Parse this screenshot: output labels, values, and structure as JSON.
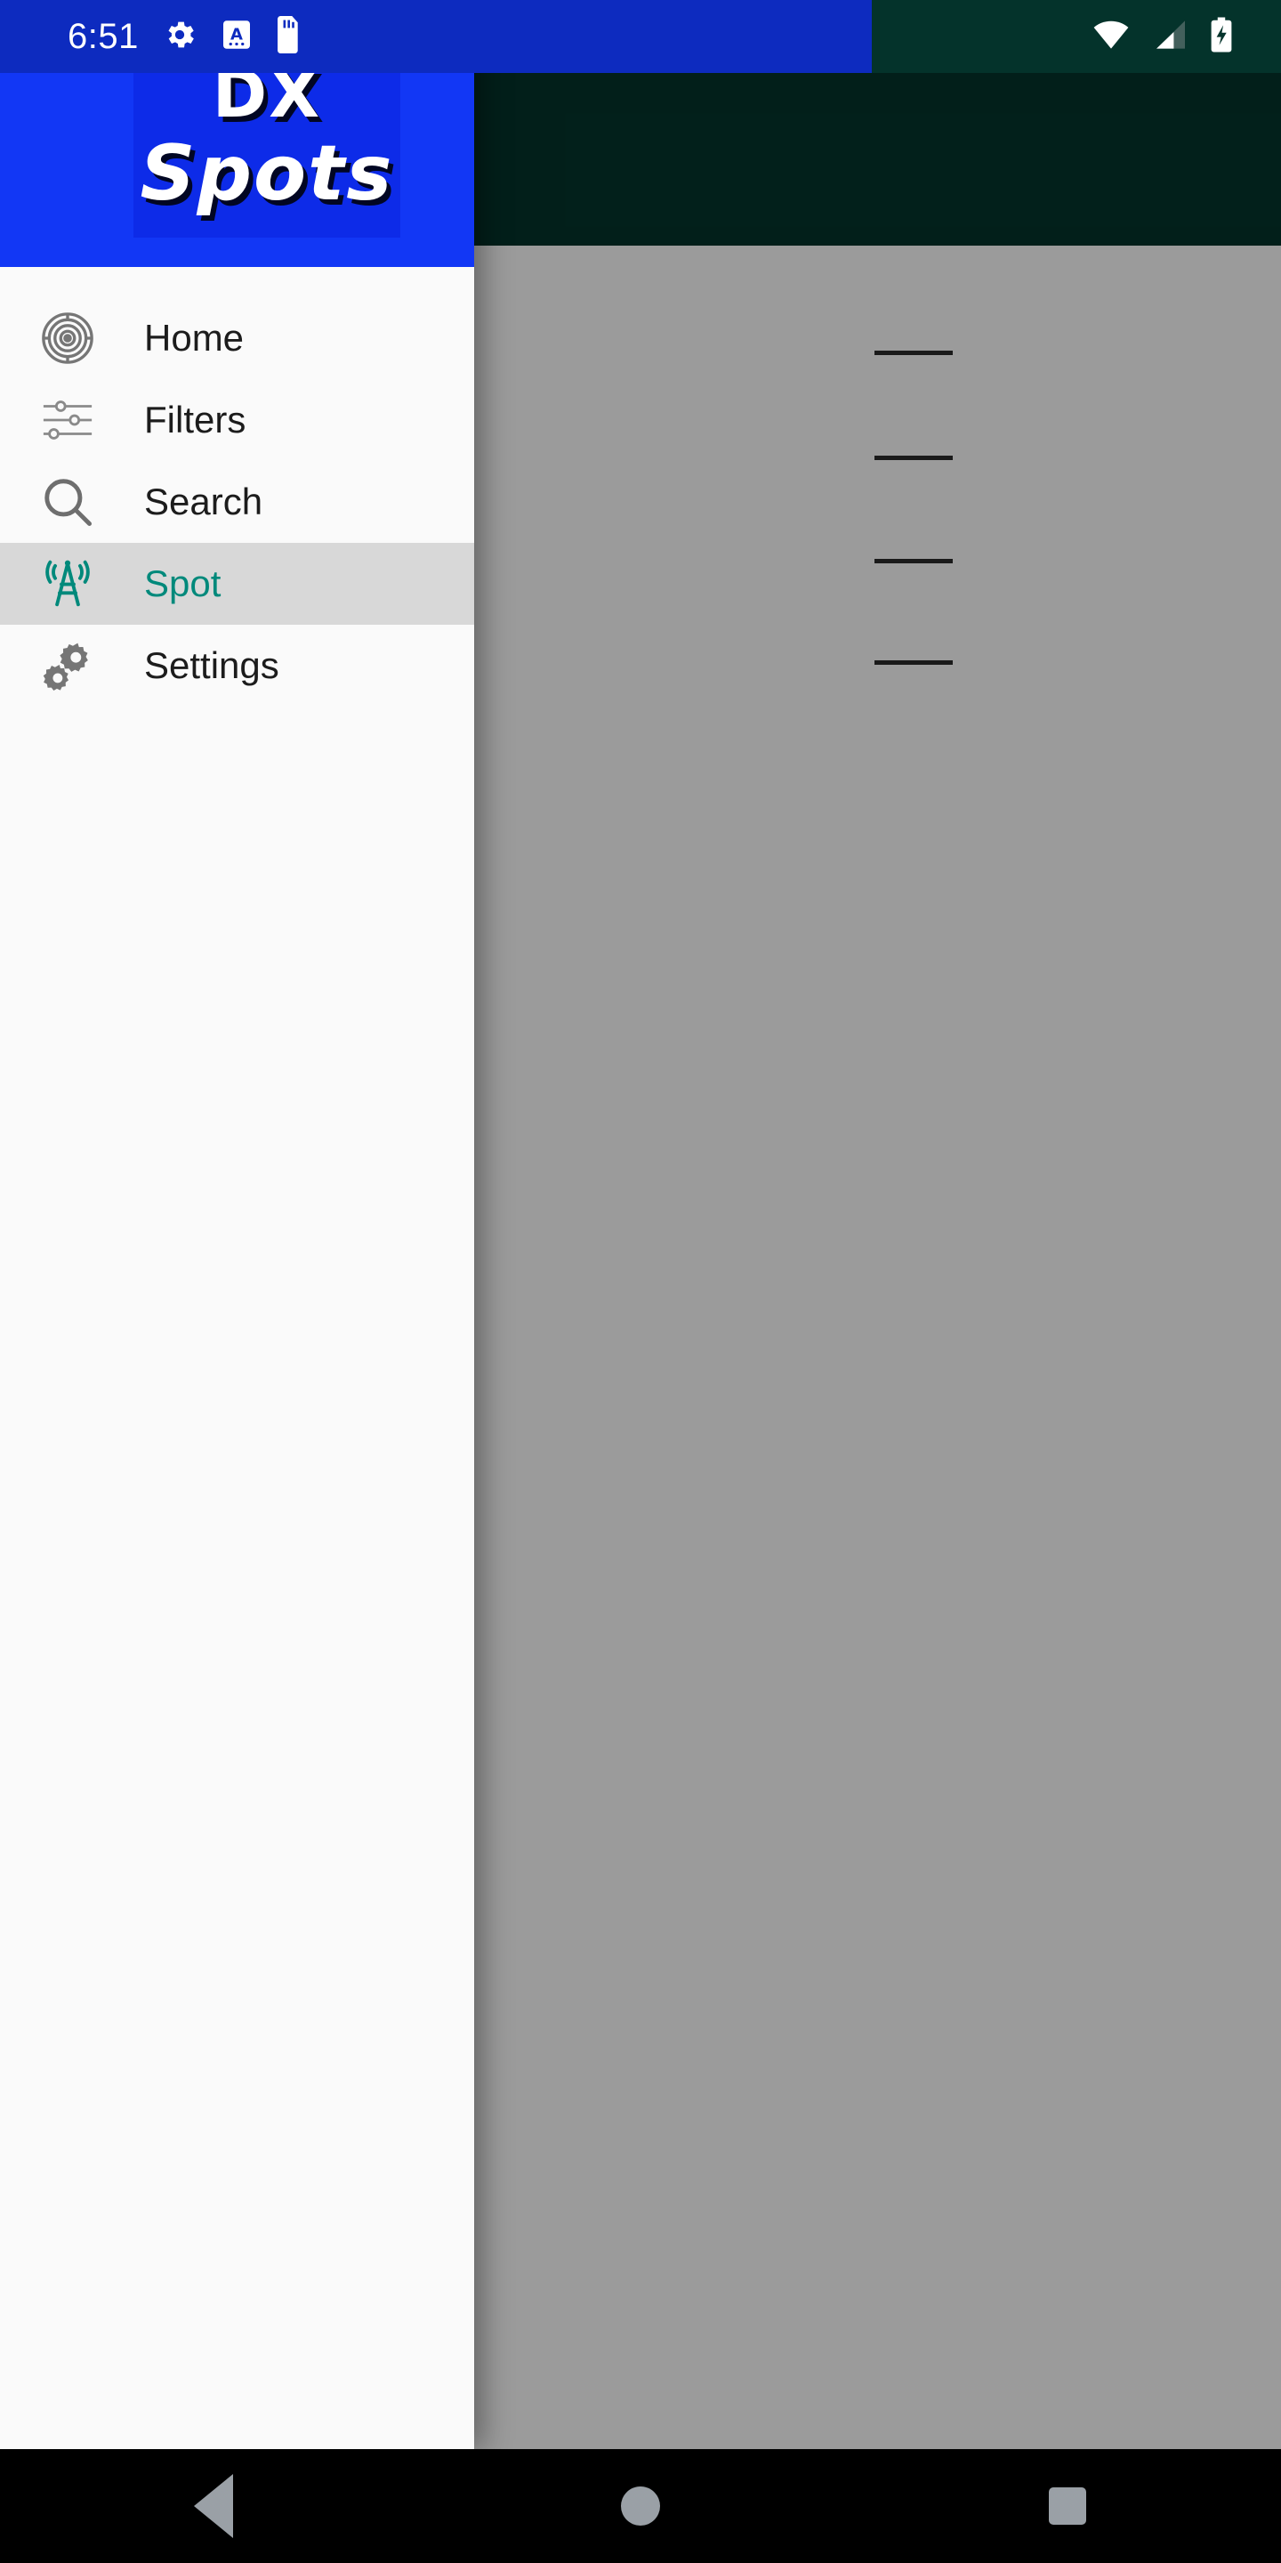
{
  "status_bar": {
    "time": "6:51",
    "left_icons": [
      "gear-icon",
      "font-size-icon",
      "sd-card-icon"
    ],
    "right_icons": [
      "wifi-icon",
      "cellular-signal-icon",
      "battery-charging-icon"
    ],
    "left_bg_color": "#0D2BBF",
    "right_bg_color": "#04332B"
  },
  "drawer": {
    "header": {
      "logo_line1": "DX",
      "logo_line2": "Spots",
      "bg_color": "#1237F5",
      "logo_box_color": "#0D2BE8"
    },
    "selected_color": "#00897B",
    "selected_row_bg": "#D8D8D8",
    "items": [
      {
        "label": "Home",
        "icon": "radar-target-icon",
        "selected": false
      },
      {
        "label": "Filters",
        "icon": "sliders-icon",
        "selected": false
      },
      {
        "label": "Search",
        "icon": "magnifier-icon",
        "selected": false
      },
      {
        "label": "Spot",
        "icon": "radio-tower-icon",
        "selected": true
      },
      {
        "label": "Settings",
        "icon": "gears-icon",
        "selected": false
      }
    ]
  },
  "background_app": {
    "app_bar_color": "#04332B",
    "surface_color": "#FAFAFA",
    "scrim_color": "rgba(0,0,0,0.38)",
    "divider_count": 4,
    "divider_tops": [
      394,
      512,
      628,
      742
    ]
  },
  "navigation_bar": {
    "bg_color": "#000000",
    "icon_color": "#9AA0A6",
    "buttons": [
      "back-button",
      "home-button",
      "recents-button"
    ]
  }
}
